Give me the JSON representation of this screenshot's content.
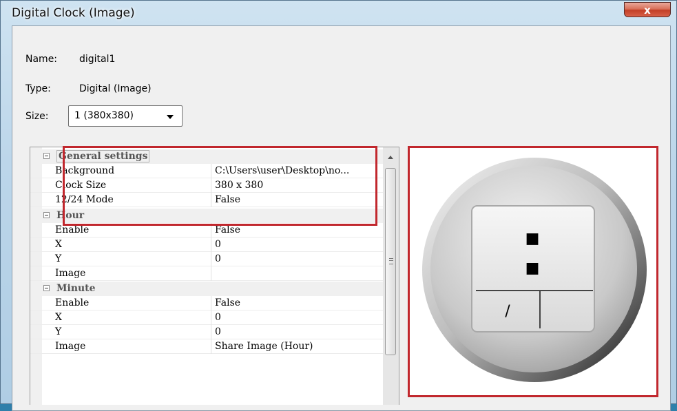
{
  "window": {
    "title": "Digital Clock (Image)",
    "close_glyph": "x"
  },
  "fields": {
    "name_label": "Name:",
    "name_value": "digital1",
    "type_label": "Type:",
    "type_value": "Digital (Image)",
    "size_label": "Size:",
    "size_value": "1  (380x380)"
  },
  "grid": {
    "general": {
      "title": "General settings",
      "rows": [
        {
          "k": "Background",
          "v": "C:\\Users\\user\\Desktop\\no..."
        },
        {
          "k": "Clock Size",
          "v": "380 x 380"
        },
        {
          "k": "12/24 Mode",
          "v": "False"
        }
      ]
    },
    "hour": {
      "title": "Hour",
      "rows": [
        {
          "k": "Enable",
          "v": "False"
        },
        {
          "k": "X",
          "v": "0"
        },
        {
          "k": "Y",
          "v": "0"
        },
        {
          "k": "Image",
          "v": ""
        }
      ]
    },
    "minute": {
      "title": "Minute",
      "rows": [
        {
          "k": "Enable",
          "v": "False"
        },
        {
          "k": "X",
          "v": "0"
        },
        {
          "k": "Y",
          "v": "0"
        },
        {
          "k": "Image",
          "v": "Share Image (Hour)"
        }
      ]
    }
  },
  "preview": {
    "colon_top": "■",
    "colon_bottom": "■",
    "slash": "/"
  },
  "colors": {
    "highlight": "#c1272d",
    "titlebar": "#bcd6ea"
  }
}
